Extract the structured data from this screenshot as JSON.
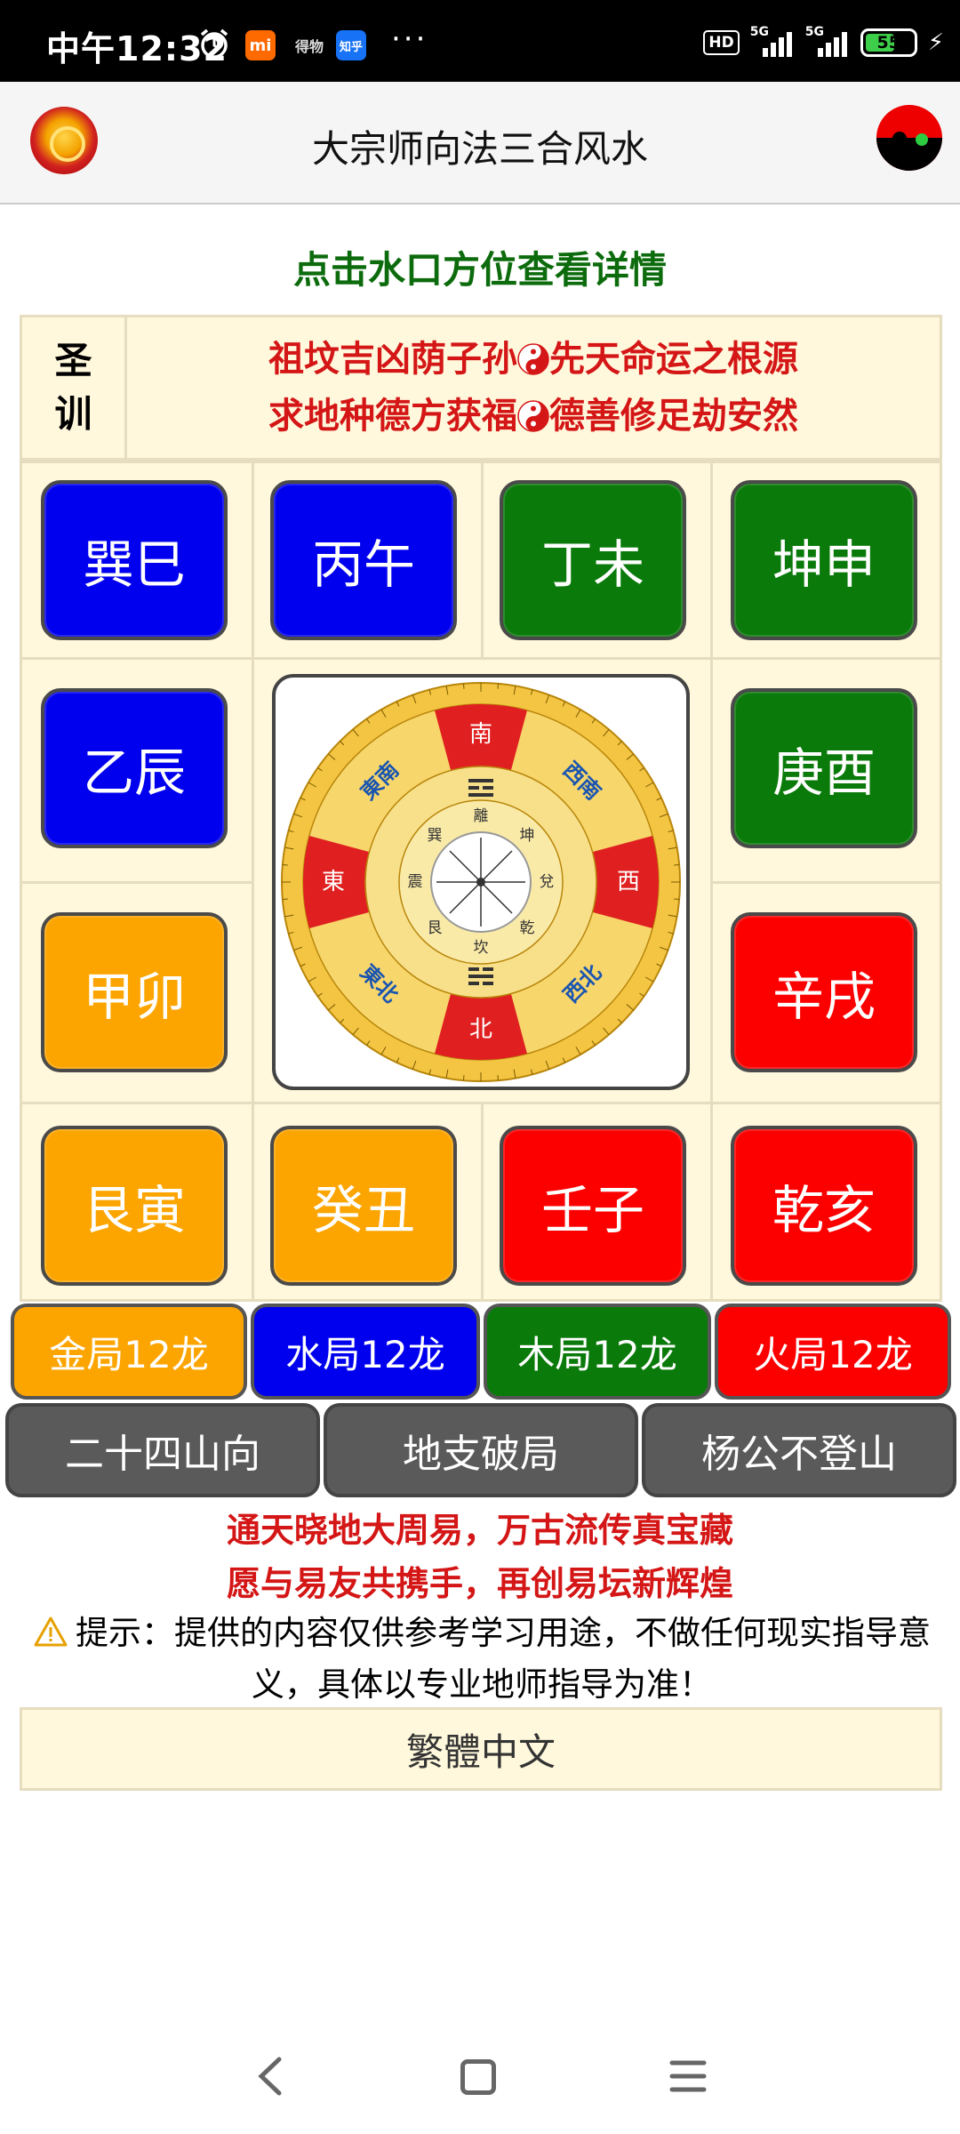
{
  "statusbar": {
    "time": "中午12:32",
    "app_mi": "mi",
    "app_dewu": "得物",
    "app_zhihu": "知乎",
    "more": "···",
    "hd": "HD",
    "net1": "5G",
    "net2": "5G",
    "battery": "55"
  },
  "header": {
    "title": "大宗师向法三合风水",
    "left_icon": "dragon-logo-icon",
    "right_icon": "yin-yang-icon"
  },
  "subtitle": "点击水口方位查看详情",
  "motto": {
    "label_line1": "圣",
    "label_line2": "训",
    "line1_a": "祖坟吉凶荫子孙",
    "line1_b": "先天命运之根源",
    "line2_a": "求地种德方获福",
    "line2_b": "德善修足劫安然"
  },
  "directions": {
    "xunsi": "巽巳",
    "bingwu": "丙午",
    "dingwei": "丁未",
    "kunshen": "坤申",
    "yichen": "乙辰",
    "gengyou": "庚酉",
    "jiamao": "甲卯",
    "xinxu": "辛戌",
    "genyin": "艮寅",
    "guichou": "癸丑",
    "renzi": "壬子",
    "qianhai": "乾亥"
  },
  "compass": {
    "south": "南",
    "north": "北",
    "east": "東",
    "west": "西",
    "southeast": "東南",
    "southwest": "西南",
    "northeast": "東北",
    "northwest": "西北",
    "li": "離",
    "kan": "坎",
    "zhen": "震",
    "dui": "兌",
    "xun": "巽",
    "kun": "坤",
    "gen": "艮",
    "qian": "乾"
  },
  "groups": {
    "jin": "金局12龙",
    "shui": "水局12龙",
    "mu": "木局12龙",
    "huo": "火局12龙"
  },
  "tools": {
    "shanxiang": "二十四山向",
    "dizhi": "地支破局",
    "yanggong": "杨公不登山"
  },
  "verse": {
    "line1": "通天晓地大周易，万古流传真宝藏",
    "line2": "愿与易友共携手，再创易坛新辉煌"
  },
  "tip": {
    "icon": "warning-icon",
    "line1": "提示：提供的内容仅供参考学习用途，不做任何现实指导意",
    "line2": "义，具体以专业地师指导为准！"
  },
  "traditional_button": "繁體中文",
  "colors": {
    "blue": "#0000ee",
    "green": "#0a7a0a",
    "orange": "#fca500",
    "red": "#fc0000",
    "subtitle_green": "#0c6b0c",
    "verse_red": "#d41616",
    "panel_bg": "#fff8dc"
  }
}
